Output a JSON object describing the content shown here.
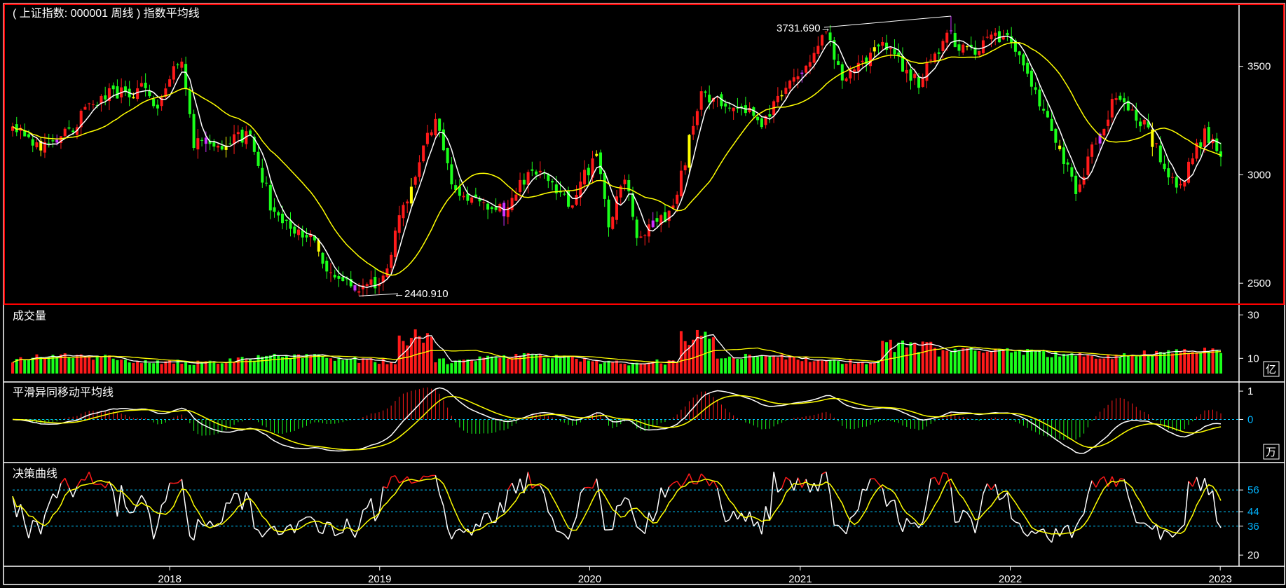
{
  "chart_data": [
    {
      "type": "candlestick",
      "title": "( 上证指数: 000001 周线 ) 指数平均线",
      "period": "weekly",
      "x_range": [
        "2017-04",
        "2023-01"
      ],
      "y_ticks": [
        2500,
        3000,
        3500
      ],
      "ylim": [
        2410,
        3780
      ],
      "annotations": [
        {
          "label": "3731.690→",
          "value": 3731.69,
          "kind": "high"
        },
        {
          "label": "←2440.910",
          "value": 2440.91,
          "kind": "low"
        }
      ],
      "series": [
        {
          "kind": "candles",
          "note": "open/high/low/close weekly bars (approximate reconstruction)"
        },
        {
          "kind": "ma_fast",
          "color": "#ffffff"
        },
        {
          "kind": "ma_slow",
          "color": "#ffff00"
        }
      ],
      "colors": {
        "up": "#ff1a1a",
        "down": "#1aff1a",
        "yellow_candle": "#ffff00",
        "purple_candle": "#cc33ff"
      },
      "price_path_keypoints": [
        [
          "2017-04-03",
          3240
        ],
        [
          "2017-06-05",
          3110
        ],
        [
          "2017-09-04",
          3360
        ],
        [
          "2017-11-13",
          3400
        ],
        [
          "2017-12-11",
          3300
        ],
        [
          "2018-01-22",
          3550
        ],
        [
          "2018-02-12",
          3150
        ],
        [
          "2018-04-09",
          3150
        ],
        [
          "2018-05-21",
          3180
        ],
        [
          "2018-07-02",
          2800
        ],
        [
          "2018-09-03",
          2720
        ],
        [
          "2018-10-15",
          2500
        ],
        [
          "2018-12-31",
          2480
        ],
        [
          "2019-02-18",
          2900
        ],
        [
          "2019-04-08",
          3270
        ],
        [
          "2019-05-13",
          2920
        ],
        [
          "2019-08-12",
          2820
        ],
        [
          "2019-09-16",
          3030
        ],
        [
          "2019-12-02",
          2870
        ],
        [
          "2020-01-13",
          3110
        ],
        [
          "2020-02-03",
          2760
        ],
        [
          "2020-03-02",
          3010
        ],
        [
          "2020-03-23",
          2680
        ],
        [
          "2020-05-25",
          2850
        ],
        [
          "2020-07-13",
          3380
        ],
        [
          "2020-09-14",
          3320
        ],
        [
          "2020-10-26",
          3230
        ],
        [
          "2020-12-28",
          3470
        ],
        [
          "2021-02-15",
          3650
        ],
        [
          "2021-03-15",
          3440
        ],
        [
          "2021-05-31",
          3600
        ],
        [
          "2021-07-26",
          3420
        ],
        [
          "2021-09-13",
          3650
        ],
        [
          "2021-10-18",
          3560
        ],
        [
          "2021-12-13",
          3640
        ],
        [
          "2022-01-03",
          3600
        ],
        [
          "2022-03-14",
          3220
        ],
        [
          "2022-04-25",
          2930
        ],
        [
          "2022-07-04",
          3370
        ],
        [
          "2022-08-29",
          3200
        ],
        [
          "2022-10-17",
          2920
        ],
        [
          "2022-12-05",
          3200
        ],
        [
          "2023-01-02",
          3100
        ]
      ]
    },
    {
      "type": "bar",
      "title": "成交量",
      "y_ticks": [
        10,
        30
      ],
      "unit": "亿",
      "ylim": [
        3,
        33
      ],
      "colors": {
        "up": "#ff1a1a",
        "down": "#1aff1a",
        "ma_fast": "#ffffff",
        "ma_slow": "#ffff00"
      }
    },
    {
      "type": "line",
      "title": "平滑异同移动平均线",
      "y_ticks": [
        0,
        1
      ],
      "unit": "万",
      "ylim": [
        -1.4,
        1.25
      ],
      "series": [
        {
          "kind": "dif",
          "color": "#ffffff"
        },
        {
          "kind": "dea",
          "color": "#ffff00"
        },
        {
          "kind": "histogram"
        }
      ]
    },
    {
      "type": "line",
      "title": "决策曲线",
      "y_ticks": [
        20,
        36,
        44,
        56
      ],
      "ylim": [
        15,
        70
      ],
      "reference_lines": [
        36,
        44,
        56
      ],
      "series": [
        {
          "kind": "curve",
          "color": "#ffffff",
          "above_56": "#ff1a1a"
        },
        {
          "kind": "signal",
          "color": "#ffff00"
        }
      ]
    }
  ],
  "x_axis": {
    "labels": [
      "2018",
      "2019",
      "2020",
      "2021",
      "2022",
      "2023"
    ]
  },
  "colors": {
    "frame": "#ffffff",
    "active_frame": "#ff0000",
    "grid": "#00c8ff",
    "background": "#000000"
  }
}
